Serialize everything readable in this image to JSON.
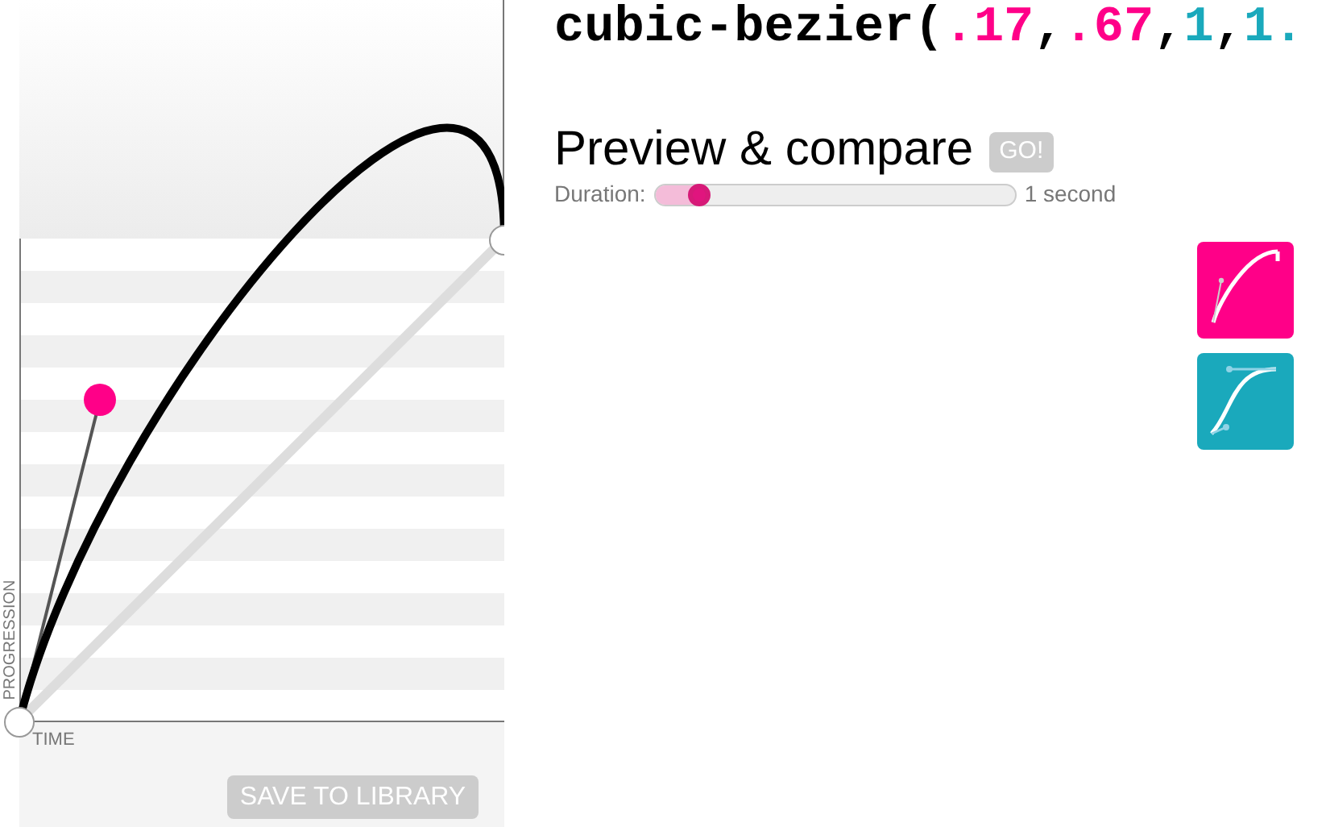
{
  "code": [
    {
      "kind": "plain",
      "text": "cubic-bezier("
    },
    {
      "kind": "p1",
      "text": ".17"
    },
    {
      "kind": "plain",
      "text": ","
    },
    {
      "kind": "p1",
      "text": ".67"
    },
    {
      "kind": "plain",
      "text": ","
    },
    {
      "kind": "p2",
      "text": "1"
    },
    {
      "kind": "plain",
      "text": ","
    },
    {
      "kind": "p2",
      "text": "1."
    }
  ],
  "graph": {
    "y_axis": "PROGRESSION",
    "x_axis": "TIME",
    "save_button": "SAVE TO LIBRARY"
  },
  "preview": {
    "title": "Preview & compare",
    "go_button": "GO!",
    "duration_label": "Duration:",
    "duration": {
      "level": 0.12
    },
    "duration_reading": "1 second"
  },
  "thumbnails": [
    {
      "color": "#ff0088"
    },
    {
      "color": "#1aa9bc"
    }
  ]
}
